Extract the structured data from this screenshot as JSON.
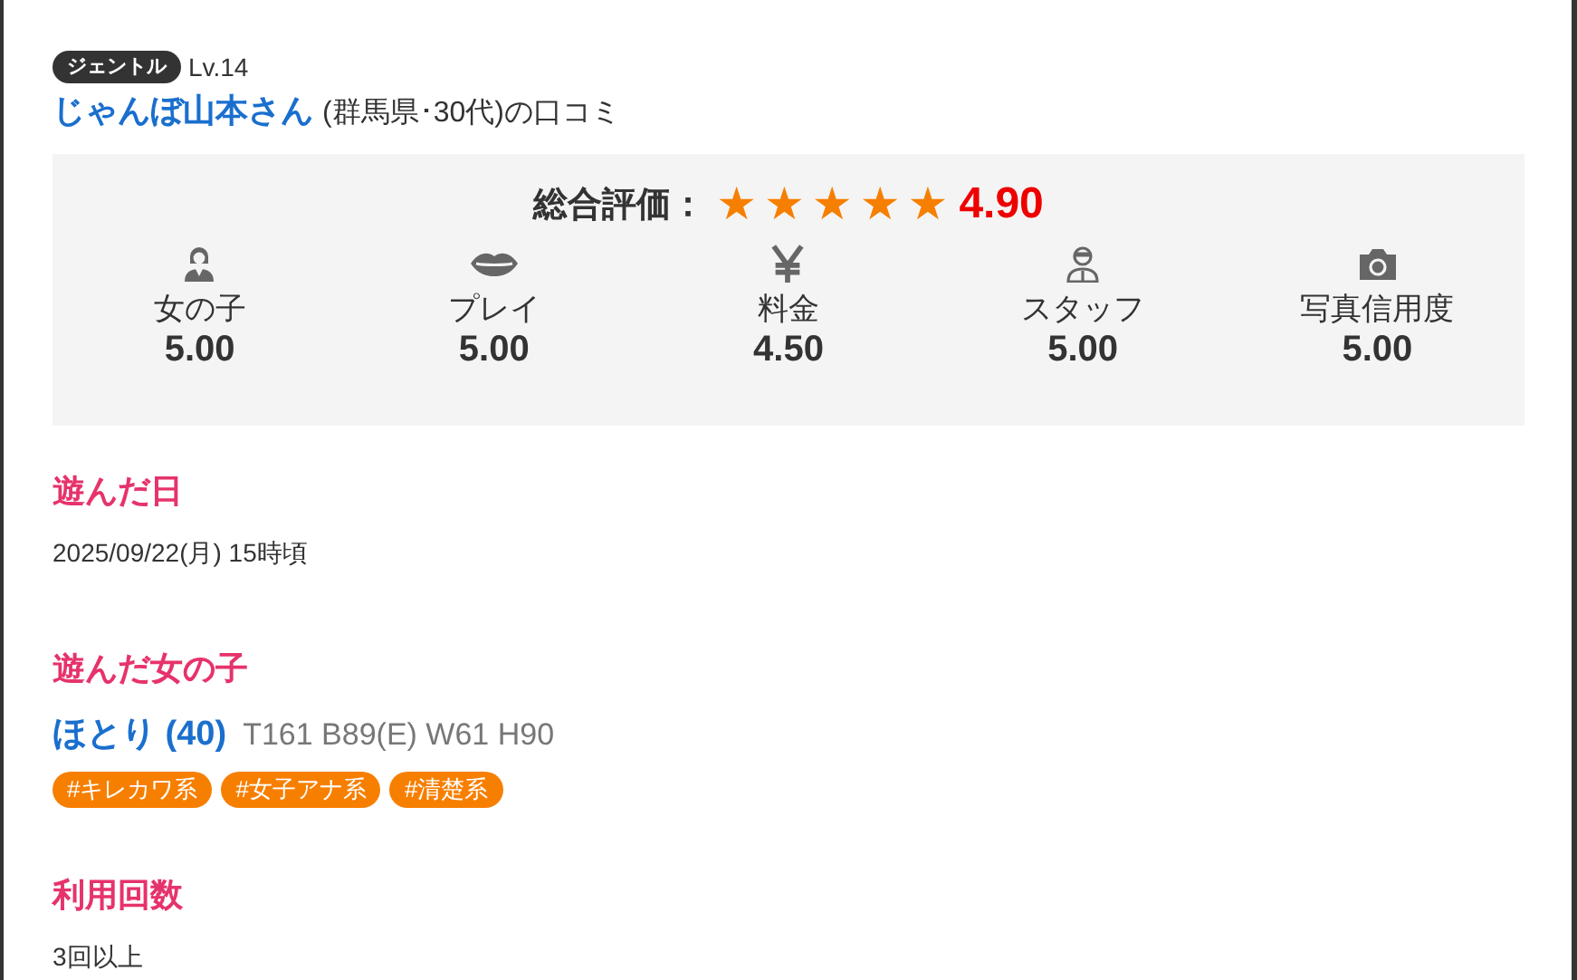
{
  "reviewer": {
    "rank": "ジェントル",
    "level": "Lv.14",
    "name": "じゃんぼ山本さん",
    "suffix": "(群馬県･30代)の口コミ"
  },
  "overall": {
    "label": "総合評価：",
    "stars": 5,
    "score": "4.90"
  },
  "ratings": [
    {
      "kind": "girl",
      "label": "女の子",
      "score": "5.00"
    },
    {
      "kind": "lips",
      "label": "プレイ",
      "score": "5.00"
    },
    {
      "kind": "yen",
      "label": "料金",
      "score": "4.50"
    },
    {
      "kind": "staff",
      "label": "スタッフ",
      "score": "5.00"
    },
    {
      "kind": "camera",
      "label": "写真信用度",
      "score": "5.00"
    }
  ],
  "visit_date": {
    "heading": "遊んだ日",
    "value": "2025/09/22(月) 15時頃"
  },
  "girl": {
    "heading": "遊んだ女の子",
    "name": "ほとり (40)",
    "measurements": "T161 B89(E) W61 H90",
    "tags": [
      "#キレカワ系",
      "#女子アナ系",
      "#清楚系"
    ]
  },
  "usage": {
    "heading": "利用回数",
    "value": "3回以上"
  }
}
